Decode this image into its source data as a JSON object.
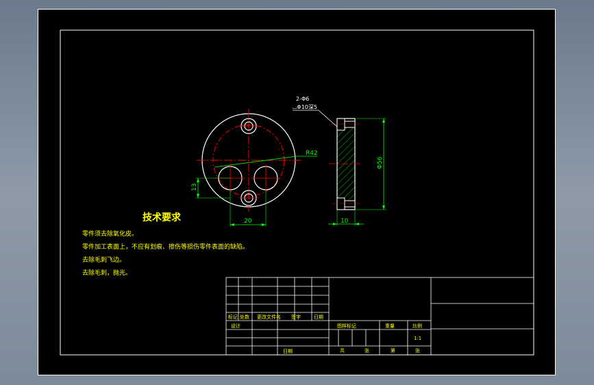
{
  "drawing": {
    "front_view": {
      "hole_callout_line1": "2-Φ6",
      "hole_callout_line2": "⌴Φ10深5",
      "bolt_circle_dim": "R42",
      "offset_dim_vertical": "13",
      "offset_dim_horizontal": "20"
    },
    "side_view": {
      "diameter_dim": "Φ56",
      "thickness_dim": "10"
    },
    "tech_requirements": {
      "title": "技术要求",
      "items": [
        "零件须去除氧化皮。",
        "零件加工表面上，不应有划痕、擦伤等损伤零件表面的缺陷。",
        "去除毛刺飞边。",
        "去除毛刺，抛光。"
      ]
    },
    "title_block": {
      "rev_headers": [
        "标记",
        "处数",
        "更改文件名",
        "签字",
        "日期"
      ],
      "design_label": "设计",
      "date_label": "日期",
      "stage_mark": "图样标记",
      "weight": "重量",
      "scale": "比例",
      "scale_value": "1:1",
      "total_label": "共",
      "sheet_unit_1": "张",
      "sheet_label": "第",
      "sheet_unit_2": "张"
    },
    "colors": {
      "sheet": "#000000",
      "border": "#ffffff",
      "outline": "#ffffff",
      "centerline": "#ff0000",
      "dimension": "#00ff00",
      "hatch": "#00ff00",
      "callout": "#ffff00"
    }
  }
}
